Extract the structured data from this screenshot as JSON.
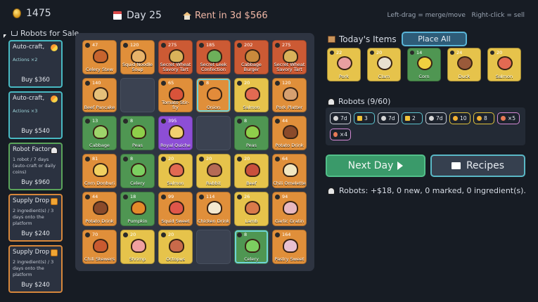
{
  "topbar": {
    "money": "1475",
    "day": "Day 25",
    "rent": "Rent in 3d $566",
    "hint": "Left-drag = merge/move   Right-click = sell"
  },
  "sale": {
    "header": "Robots for Sale",
    "cards": [
      {
        "title": "Auto-craft,",
        "desc": "Actions ×2",
        "price": "Buy $360",
        "icon": "wand-icon"
      },
      {
        "title": "Auto-craft,",
        "desc": "Actions ×3",
        "price": "Buy $540",
        "icon": "wand-icon"
      },
      {
        "title": "Robot Factory",
        "desc": "1 robot / 7 days (auto-craft or daily coins)",
        "price": "Buy $960",
        "icon": "robot-icon"
      },
      {
        "title": "Supply Drop",
        "desc": "2 ingredient(s) / 3 days onto the platform",
        "price": "Buy $240",
        "icon": "gift-icon"
      },
      {
        "title": "Supply Drop",
        "desc": "2 ingredient(s) / 3 days onto the platform",
        "price": "Buy $240",
        "icon": "gift-icon"
      }
    ]
  },
  "board": {
    "rows": [
      [
        {
          "count": "47",
          "name": "Celery Stew",
          "color": "c-orange",
          "food": "#c7642e"
        },
        {
          "count": "120",
          "name": "Squid Noodle Soup",
          "color": "c-orange",
          "food": "#e8b36a"
        },
        {
          "count": "275",
          "name": "Secret Wheat Savory Tart",
          "color": "c-red",
          "food": "#d9b25a"
        },
        {
          "count": "185",
          "name": "Secret Leek Confection",
          "color": "c-red",
          "food": "#6db05a"
        },
        {
          "count": "202",
          "name": "Cabbage Burger",
          "color": "c-red",
          "food": "#c98a3c"
        },
        {
          "count": "275",
          "name": "Secret Wheat Savory Tart",
          "color": "c-red",
          "food": "#d9b25a"
        }
      ],
      [
        {
          "count": "140",
          "name": "Beef Pancake",
          "color": "c-orange",
          "food": "#e5c07a"
        },
        {
          "count": "",
          "name": "",
          "color": "c-empty",
          "food": ""
        },
        {
          "count": "65",
          "name": "Tomato Stir-fry",
          "color": "c-orange",
          "food": "#d8533a"
        },
        {
          "count": "8",
          "name": "Onion",
          "color": "c-orange",
          "food": "#e38b3a",
          "sel": true
        },
        {
          "count": "20",
          "name": "Salmon",
          "color": "c-yellow",
          "food": "#e26a52"
        },
        {
          "count": "120",
          "name": "Pork Platter",
          "color": "c-orange",
          "food": "#d6a070"
        }
      ],
      [
        {
          "count": "13",
          "name": "Cabbage",
          "color": "c-green",
          "food": "#9ed46a"
        },
        {
          "count": "8",
          "name": "Peas",
          "color": "c-green",
          "food": "#8fcf4a"
        },
        {
          "count": "395",
          "name": "Royal Quiche",
          "color": "c-purple",
          "food": "#f0d070"
        },
        {
          "count": "",
          "name": "",
          "color": "c-empty",
          "food": ""
        },
        {
          "count": "8",
          "name": "Peas",
          "color": "c-green",
          "food": "#8fcf4a"
        },
        {
          "count": "44",
          "name": "Potato Drink",
          "color": "c-orange",
          "food": "#8a4a2a"
        }
      ],
      [
        {
          "count": "81",
          "name": "Corn Donburi",
          "color": "c-orange",
          "food": "#f0d060"
        },
        {
          "count": "8",
          "name": "Celery",
          "color": "c-green",
          "food": "#7ccf60"
        },
        {
          "count": "20",
          "name": "Salmon",
          "color": "c-yellow",
          "food": "#e26a52"
        },
        {
          "count": "20",
          "name": "Rabbit",
          "color": "c-yellow",
          "food": "#b56a55"
        },
        {
          "count": "20",
          "name": "Beef",
          "color": "c-yellow",
          "food": "#c9503c"
        },
        {
          "count": "64",
          "name": "Chili Omelette",
          "color": "c-orange",
          "food": "#f2e6c0"
        }
      ],
      [
        {
          "count": "44",
          "name": "Potato Drink",
          "color": "c-orange",
          "food": "#8a4a2a"
        },
        {
          "count": "18",
          "name": "Pumpkin",
          "color": "c-green",
          "food": "#e48a2a"
        },
        {
          "count": "99",
          "name": "Squid Sweet",
          "color": "c-orange",
          "food": "#e0564a"
        },
        {
          "count": "114",
          "name": "Chicken Drink",
          "color": "c-orange",
          "food": "#f3e8d0"
        },
        {
          "count": "26",
          "name": "Lamb",
          "color": "c-yellow",
          "food": "#d97a4a"
        },
        {
          "count": "94",
          "name": "Garlic Gratin",
          "color": "c-orange",
          "food": "#e8b8c0"
        }
      ],
      [
        {
          "count": "70",
          "name": "Chili Skewers",
          "color": "c-orange",
          "food": "#c95a30"
        },
        {
          "count": "20",
          "name": "Shrimp",
          "color": "c-yellow",
          "food": "#f0a0a0"
        },
        {
          "count": "20",
          "name": "Octopus",
          "color": "c-yellow",
          "food": "#c96a4a"
        },
        {
          "count": "",
          "name": "",
          "color": "c-empty",
          "food": ""
        },
        {
          "count": "8",
          "name": "Celery",
          "color": "c-green",
          "food": "#7ccf60",
          "sel": true
        },
        {
          "count": "164",
          "name": "Pastry Sweet",
          "color": "c-orange",
          "food": "#e8c0d0"
        }
      ]
    ]
  },
  "today": {
    "header": "Today's Items",
    "place_all": "Place All",
    "items": [
      {
        "count": "22",
        "name": "Pork",
        "color": "",
        "food": "#e8a0a0"
      },
      {
        "count": "20",
        "name": "Clam",
        "color": "",
        "food": "#e8e0d0"
      },
      {
        "count": "14",
        "name": "Corn",
        "color": "c-green",
        "food": "#f0d040"
      },
      {
        "count": "24",
        "name": "Duck",
        "color": "",
        "food": "#9a5a3a"
      },
      {
        "count": "20",
        "name": "Salmon",
        "color": "",
        "food": "#e26a52"
      }
    ]
  },
  "robots": {
    "header": "Robots (9/60)",
    "chips": [
      {
        "label": "7d",
        "style": "",
        "icon": "robot"
      },
      {
        "label": "3",
        "style": "cyan",
        "icon": "bolt"
      },
      {
        "label": "7d",
        "style": "",
        "icon": "robot"
      },
      {
        "label": "2",
        "style": "cyan",
        "icon": "bolt"
      },
      {
        "label": "7d",
        "style": "",
        "icon": "robot"
      },
      {
        "label": "10",
        "style": "yellow",
        "icon": "drop"
      },
      {
        "label": "8",
        "style": "yellow",
        "icon": "drop"
      },
      {
        "label": "×5",
        "style": "pink",
        "icon": "meat"
      },
      {
        "label": "×4",
        "style": "pink",
        "icon": "meat"
      }
    ]
  },
  "actions": {
    "next_day": "Next Day",
    "recipes": "Recipes"
  },
  "summary": "Robots: +$18, 0 new, 0 marked, 0 ingredient(s)."
}
